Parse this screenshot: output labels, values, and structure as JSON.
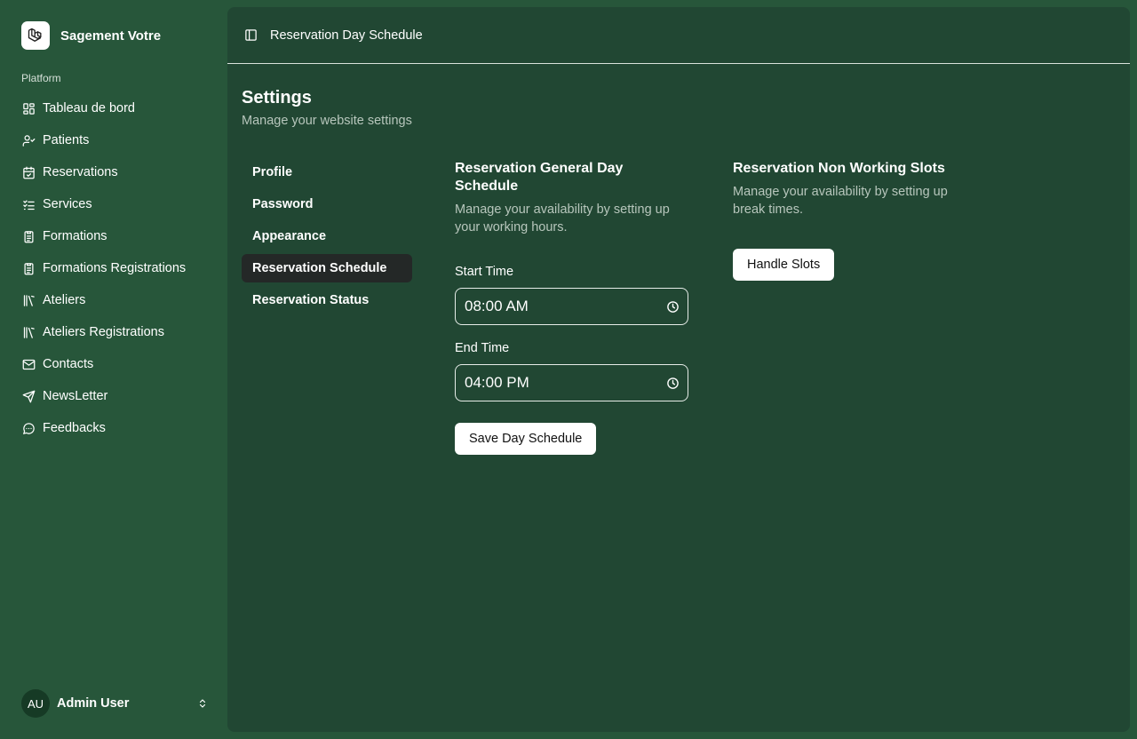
{
  "brand": {
    "name": "Sagement Votre",
    "logo_icon": "laravel-logo-icon"
  },
  "sidebar": {
    "group_label": "Platform",
    "items": [
      {
        "label": "Tableau de bord",
        "icon": "dashboard-grid-icon"
      },
      {
        "label": "Patients",
        "icon": "user-check-icon"
      },
      {
        "label": "Reservations",
        "icon": "calendar-check-icon"
      },
      {
        "label": "Services",
        "icon": "list-check-icon"
      },
      {
        "label": "Formations",
        "icon": "clipboard-list-icon"
      },
      {
        "label": "Formations Registrations",
        "icon": "clipboard-list-icon"
      },
      {
        "label": "Ateliers",
        "icon": "library-icon"
      },
      {
        "label": "Ateliers Registrations",
        "icon": "library-icon"
      },
      {
        "label": "Contacts",
        "icon": "mail-icon"
      },
      {
        "label": "NewsLetter",
        "icon": "send-icon"
      },
      {
        "label": "Feedbacks",
        "icon": "message-circle-icon"
      }
    ]
  },
  "user": {
    "initials": "AU",
    "name": "Admin User"
  },
  "header": {
    "breadcrumb": "Reservation Day Schedule"
  },
  "settings": {
    "title": "Settings",
    "subtitle": "Manage your website settings",
    "nav": [
      {
        "label": "Profile",
        "active": false
      },
      {
        "label": "Password",
        "active": false
      },
      {
        "label": "Appearance",
        "active": false
      },
      {
        "label": "Reservation Schedule",
        "active": true
      },
      {
        "label": "Reservation Status",
        "active": false
      }
    ]
  },
  "day_schedule": {
    "title": "Reservation General Day Schedule",
    "description": "Manage your availability by setting up your working hours.",
    "start_label": "Start Time",
    "start_value": "08:00 AM",
    "end_label": "End Time",
    "end_value": "04:00 PM",
    "save_label": "Save Day Schedule"
  },
  "non_working": {
    "title": "Reservation Non Working Slots",
    "description": "Manage your availability by setting up break times.",
    "button_label": "Handle Slots"
  },
  "colors": {
    "sidebar_bg": "#27563a",
    "panel_bg": "#214733",
    "active_item_bg": "#242827",
    "muted_text": "#b7c6bc"
  }
}
